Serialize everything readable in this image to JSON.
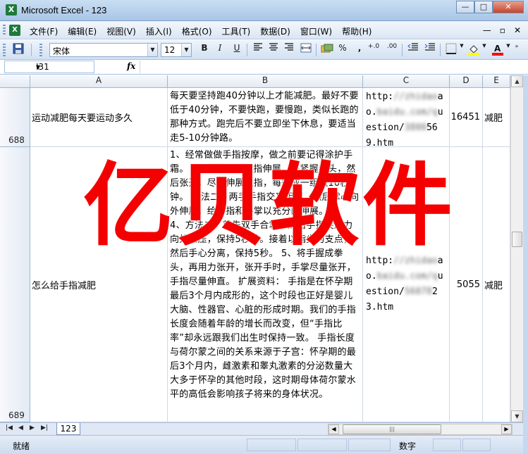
{
  "window": {
    "title": "Microsoft Excel - 123",
    "app_icon": "excel-icon",
    "controls": [
      "—",
      "□",
      "✕"
    ]
  },
  "menubar": {
    "items": [
      "文件(F)",
      "编辑(E)",
      "视图(V)",
      "插入(I)",
      "格式(O)",
      "工具(T)",
      "数据(D)",
      "窗口(W)",
      "帮助(H)"
    ],
    "doc_controls": [
      "—",
      "▫",
      "✕"
    ]
  },
  "toolbar": {
    "font_name": "宋体",
    "font_size": "12",
    "bold": "B",
    "italic": "I",
    "underline": "U",
    "percent": "%",
    "comma": ",",
    "inc_decimal": "+.0",
    "dec_decimal": ".00"
  },
  "formula_bar": {
    "name_box": "I31",
    "fx": "fx",
    "value": ""
  },
  "columns": [
    {
      "label": "A"
    },
    {
      "label": "B"
    },
    {
      "label": "C"
    },
    {
      "label": "D"
    },
    {
      "label": "E"
    }
  ],
  "rows": [
    {
      "row_number": "688",
      "a": "运动减肥每天要运动多久",
      "b": "每天要坚持跑40分钟以上才能减肥。最好不要低于40分钟，不要快跑，要慢跑，类似长跑的那种方式。跑完后不要立即坐下休息，要适当走5-10分钟路。",
      "c_visible_start": "http:",
      "c_mid1": "ao.",
      "c_mid2": "ues",
      "c_mid3": "tion/",
      "c_mid4": "569",
      "c_end": ".htm",
      "d": "16451",
      "e": "减肥"
    },
    {
      "row_number": "689",
      "a": "怎么给手指减肥",
      "b": "1、经常做做手指按摩，做之前要记得涂护手霜。 2、方法一：握指伸展，先紧握拳头，然后张开，尽量伸展五指，每完成一组做10秒钟。 方法二：两手手指交叉相握，然后掌心向外伸展，给手指和手掌以充分的伸展。 3、4、方法二：首先双手合掌，然后手指尖用力向外推压，保持5秒钟。接着以指尖为支点，然后手心分离，保持5秒。 5、将手握成拳头，再用力张开，张开手时，手掌尽量张开，手指尽量伸直。 扩展资料： 手指是在怀孕期最后3个月内成形的，这个时段也正好是婴儿大脑、性器官、心脏的形成时期。我们的手指长度会随着年龄的增长而改变，但“手指比率”却永远跟我们出生时保持一致。 手指长度与荷尔蒙之间的关系来源于子宫：怀孕期的最后3个月内，雌激素和睾丸激素的分泌数量大大多于怀孕的其他时段，这时期母体荷尔蒙水平的高低会影响孩子将来的身体状况。",
      "c_visible_start": "http:",
      "c_mid1": "ao.",
      "c_mid2": "ues",
      "c_mid3": "tion/",
      "c_mid4": "23",
      "c_end": ".htm",
      "d": "5055",
      "e": "减肥"
    }
  ],
  "sheet_tabs": {
    "active": "123",
    "nav": [
      "|◀",
      "◀",
      "▶",
      "▶|"
    ]
  },
  "statusbar": {
    "ready": "就绪",
    "mode": "数字"
  },
  "watermark": {
    "text": "亿贝软件",
    "color": "#f40000"
  }
}
